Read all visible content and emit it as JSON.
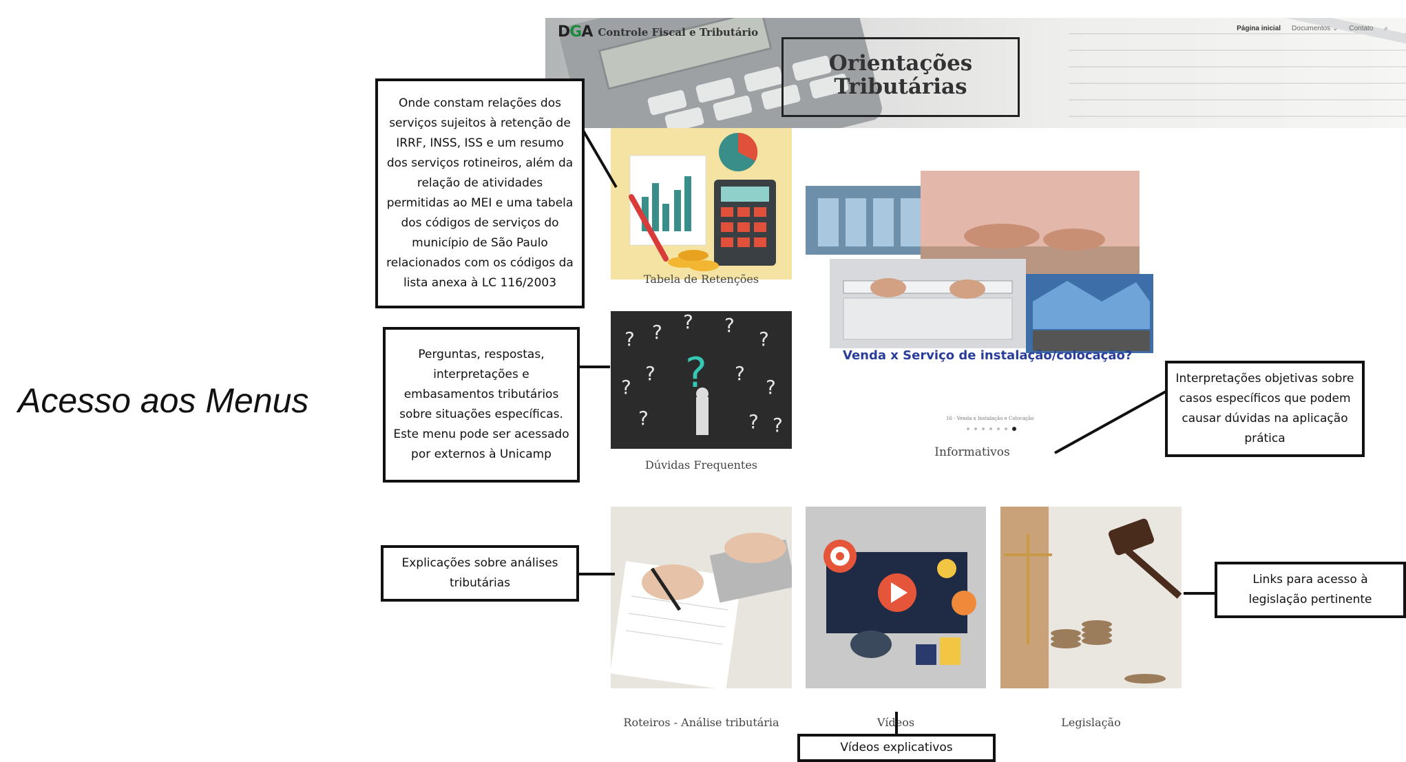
{
  "slide": {
    "title": "Acesso aos Menus"
  },
  "site": {
    "brand": "Controle Fiscal e Tributário",
    "logo": {
      "d": "D",
      "g": "G",
      "a": "A"
    },
    "nav": {
      "home": "Página inicial",
      "documents": "Documentos",
      "contact": "Contato"
    },
    "hero": {
      "title": "Orientações Tributárias"
    },
    "cards": {
      "tabela": "Tabela de Retenções",
      "duvidas": "Dúvidas Frequentes",
      "informativos": "Informativos",
      "roteiros": "Roteiros - Análise tributária",
      "videos": "Vídeos",
      "legislacao": "Legislação"
    },
    "feature": {
      "caption": "Venda x Serviço de instalação/colocação?",
      "slide_label": "16 - Venda x Instalação e Colocação"
    }
  },
  "annotations": {
    "tabela": "Onde constam relações dos serviços sujeitos à retenção de IRRF, INSS, ISS e um resumo dos serviços rotineiros, além da relação de atividades permitidas ao MEI e uma tabela dos códigos de serviços do município de São Paulo relacionados com os códigos da lista anexa à LC 116/2003",
    "duvidas": "Perguntas, respostas, interpretações e embasamentos tributários sobre situações específicas. Este menu pode ser acessado por externos à Unicamp",
    "informativos": "Interpretações objetivas sobre casos específicos que podem causar dúvidas na aplicação prática",
    "roteiros": "Explicações sobre análises tributárias",
    "legislacao": "Links para acesso à legislação pertinente",
    "videos": "Vídeos explicativos"
  },
  "colors": {
    "feature_caption": "#2a3d99",
    "logo_g": "#1c8a3c"
  }
}
